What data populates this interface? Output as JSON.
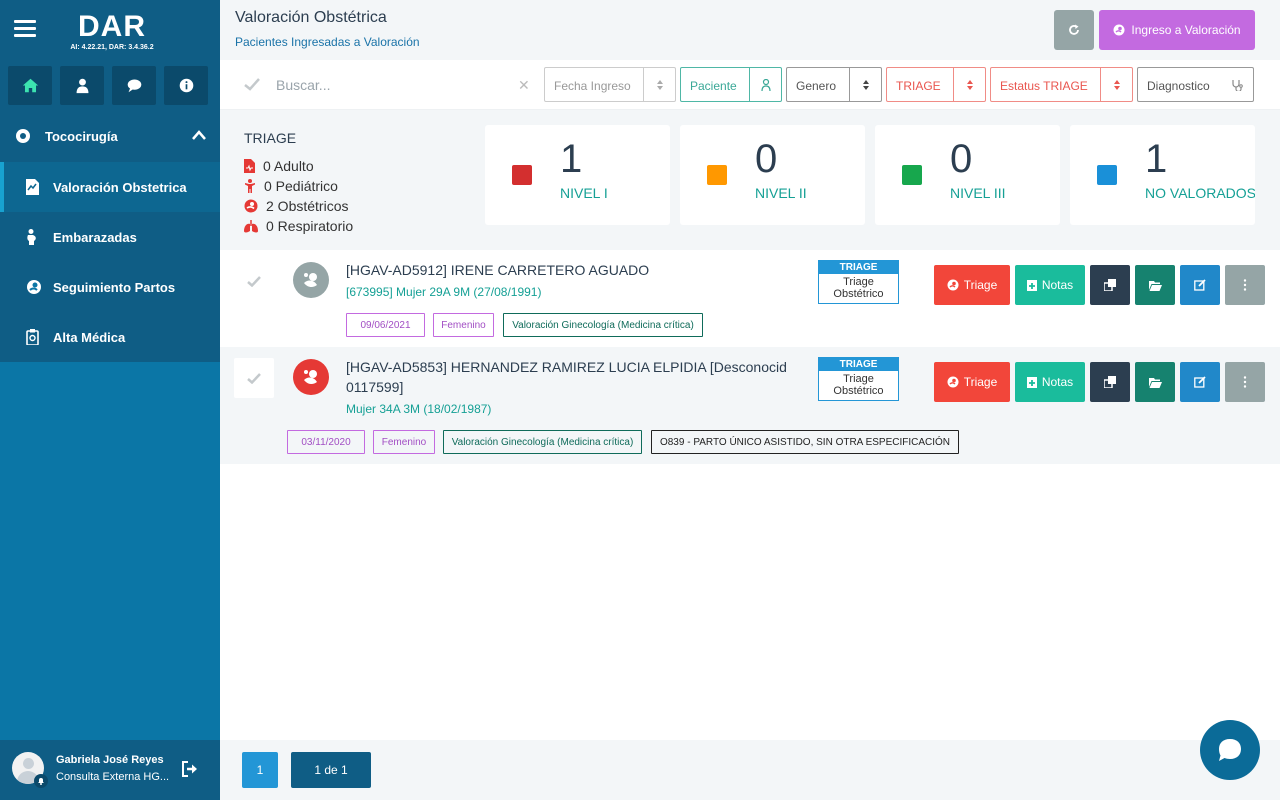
{
  "app": {
    "logo": "DAR",
    "version": "AI: 4.22.21, DAR: 3.4.36.2"
  },
  "sidebar": {
    "top_icons": [
      "home-icon",
      "user-doctor-icon",
      "chat-icon",
      "info-icon"
    ],
    "section": {
      "label": "Tococirugía",
      "icon": "tococirugia-icon"
    },
    "items": [
      {
        "label": "Valoración Obstetrica",
        "icon": "chart-file-icon",
        "active": true
      },
      {
        "label": "Embarazadas",
        "icon": "pregnant-icon",
        "active": false
      },
      {
        "label": "Seguimiento Partos",
        "icon": "baby-icon",
        "active": false
      },
      {
        "label": "Alta Médica",
        "icon": "clipboard-icon",
        "active": false
      }
    ],
    "user": {
      "name": "Gabriela José Reyes",
      "role": "Consulta Externa HG..."
    }
  },
  "header": {
    "title": "Valoración Obstétrica",
    "subtitle": "Pacientes Ingresadas a Valoración",
    "ingreso_label": "Ingreso a Valoración"
  },
  "filters": {
    "search_placeholder": "Buscar...",
    "fecha": "Fecha Ingreso",
    "paciente": "Paciente",
    "genero": "Genero",
    "triage": "TRIAGE",
    "estatus": "Estatus TRIAGE",
    "diagnostico": "Diagnostico"
  },
  "triage": {
    "title": "TRIAGE",
    "lines": [
      "0 Adulto",
      "0 Pediátrico",
      "2 Obstétricos",
      "0 Respiratorio"
    ],
    "cards": [
      {
        "num": "1",
        "label": "NIVEL I",
        "color": "#d32f2f"
      },
      {
        "num": "0",
        "label": "NIVEL II",
        "color": "#ff9800"
      },
      {
        "num": "0",
        "label": "NIVEL III",
        "color": "#17a74d"
      },
      {
        "num": "1",
        "label": "NO VALORADOS",
        "color": "#1a90d8"
      }
    ]
  },
  "patients": [
    {
      "name": "[HGAV-AD5912] IRENE CARRETERO AGUADO",
      "name2": "",
      "info": "[673995] Mujer 29A 9M (27/08/1991)",
      "date": "09/06/2021",
      "gender": "Femenino",
      "service": "Valoración Ginecología (Medicina crítica)",
      "diagnosis": "",
      "triage_head": "TRIAGE",
      "triage_body": "Triage Obstétrico",
      "icon_color": "#95a5a6"
    },
    {
      "name": "[HGAV-AD5853] HERNANDEZ RAMIREZ LUCIA ELPIDIA [Desconocid",
      "name2": "0117599]",
      "info": "Mujer 34A 3M (18/02/1987)",
      "date": "03/11/2020",
      "gender": "Femenino",
      "service": "Valoración Ginecología (Medicina crítica)",
      "diagnosis": "O839 - PARTO ÚNICO ASISTIDO, SIN OTRA ESPECIFICACIÓN",
      "triage_head": "TRIAGE",
      "triage_body": "Triage Obstétrico",
      "icon_color": "#e53935"
    }
  ],
  "actions": {
    "triage": "Triage",
    "notas": "Notas"
  },
  "pagination": {
    "current": "1",
    "info": "1 de 1"
  },
  "colors": {
    "sidebar": "#0b76a6",
    "triage_btn": "#f2463a",
    "notas_btn": "#1abc9c",
    "dark_btn": "#2c3e50",
    "folder_btn": "#16826f",
    "edit_btn": "#2188c9",
    "more_btn": "#95a5a6"
  }
}
